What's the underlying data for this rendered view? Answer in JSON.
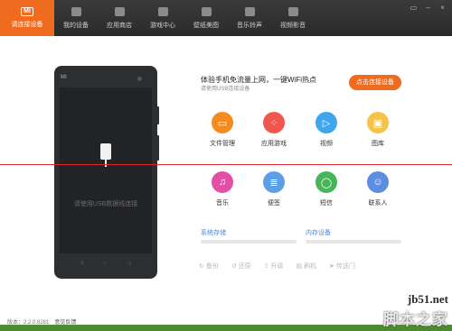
{
  "nav": {
    "active": {
      "label": "请连接设备",
      "logo": "MI"
    },
    "items": [
      {
        "label": "我的设备",
        "icon": "device-icon"
      },
      {
        "label": "应用商店",
        "icon": "store-icon"
      },
      {
        "label": "游戏中心",
        "icon": "gamepad-icon"
      },
      {
        "label": "壁纸美图",
        "icon": "wallpaper-icon"
      },
      {
        "label": "音乐铃声",
        "icon": "music-note-icon"
      },
      {
        "label": "视频影音",
        "icon": "video-icon"
      }
    ],
    "window_controls": [
      "▭",
      "–",
      "×"
    ]
  },
  "phone": {
    "brand": "MI",
    "hint": "请使用USB数据线连接",
    "keys": [
      "≡",
      "○",
      "◁"
    ]
  },
  "promo": {
    "title": "体验手机免流量上网，一键WiFi热点",
    "subtitle": "请使用USB连接设备",
    "button": "点击连接设备"
  },
  "apps": [
    {
      "label": "文件管理",
      "color": "#f58a1f",
      "glyph": "▭",
      "icon": "folder-icon"
    },
    {
      "label": "应用游戏",
      "color": "#f0584f",
      "glyph": "⁘",
      "icon": "apps-icon"
    },
    {
      "label": "视频",
      "color": "#3fa6ee",
      "glyph": "▷",
      "icon": "play-icon"
    },
    {
      "label": "图库",
      "color": "#f5c34a",
      "glyph": "▣",
      "icon": "gallery-icon"
    },
    {
      "label": "音乐",
      "color": "#e24fa6",
      "glyph": "♫",
      "icon": "music-icon"
    },
    {
      "label": "便签",
      "color": "#5d9fe6",
      "glyph": "≣",
      "icon": "note-icon"
    },
    {
      "label": "短信",
      "color": "#45b65a",
      "glyph": "◯",
      "icon": "message-icon"
    },
    {
      "label": "联系人",
      "color": "#5b8de0",
      "glyph": "☺",
      "icon": "contact-icon"
    }
  ],
  "storage": [
    {
      "label": "系统存储"
    },
    {
      "label": "内存设备"
    }
  ],
  "actions": [
    {
      "label": "备份",
      "glyph": "↻"
    },
    {
      "label": "还原",
      "glyph": "↺"
    },
    {
      "label": "升级",
      "glyph": "⇧"
    },
    {
      "label": "刷机",
      "glyph": "▤"
    },
    {
      "label": "传送门",
      "glyph": "➤"
    }
  ],
  "footer": {
    "version": "版本：2.2.0.8281",
    "feedback": "意见反馈"
  },
  "watermark": {
    "url": "jb51.net",
    "cn": "脚本之家"
  }
}
